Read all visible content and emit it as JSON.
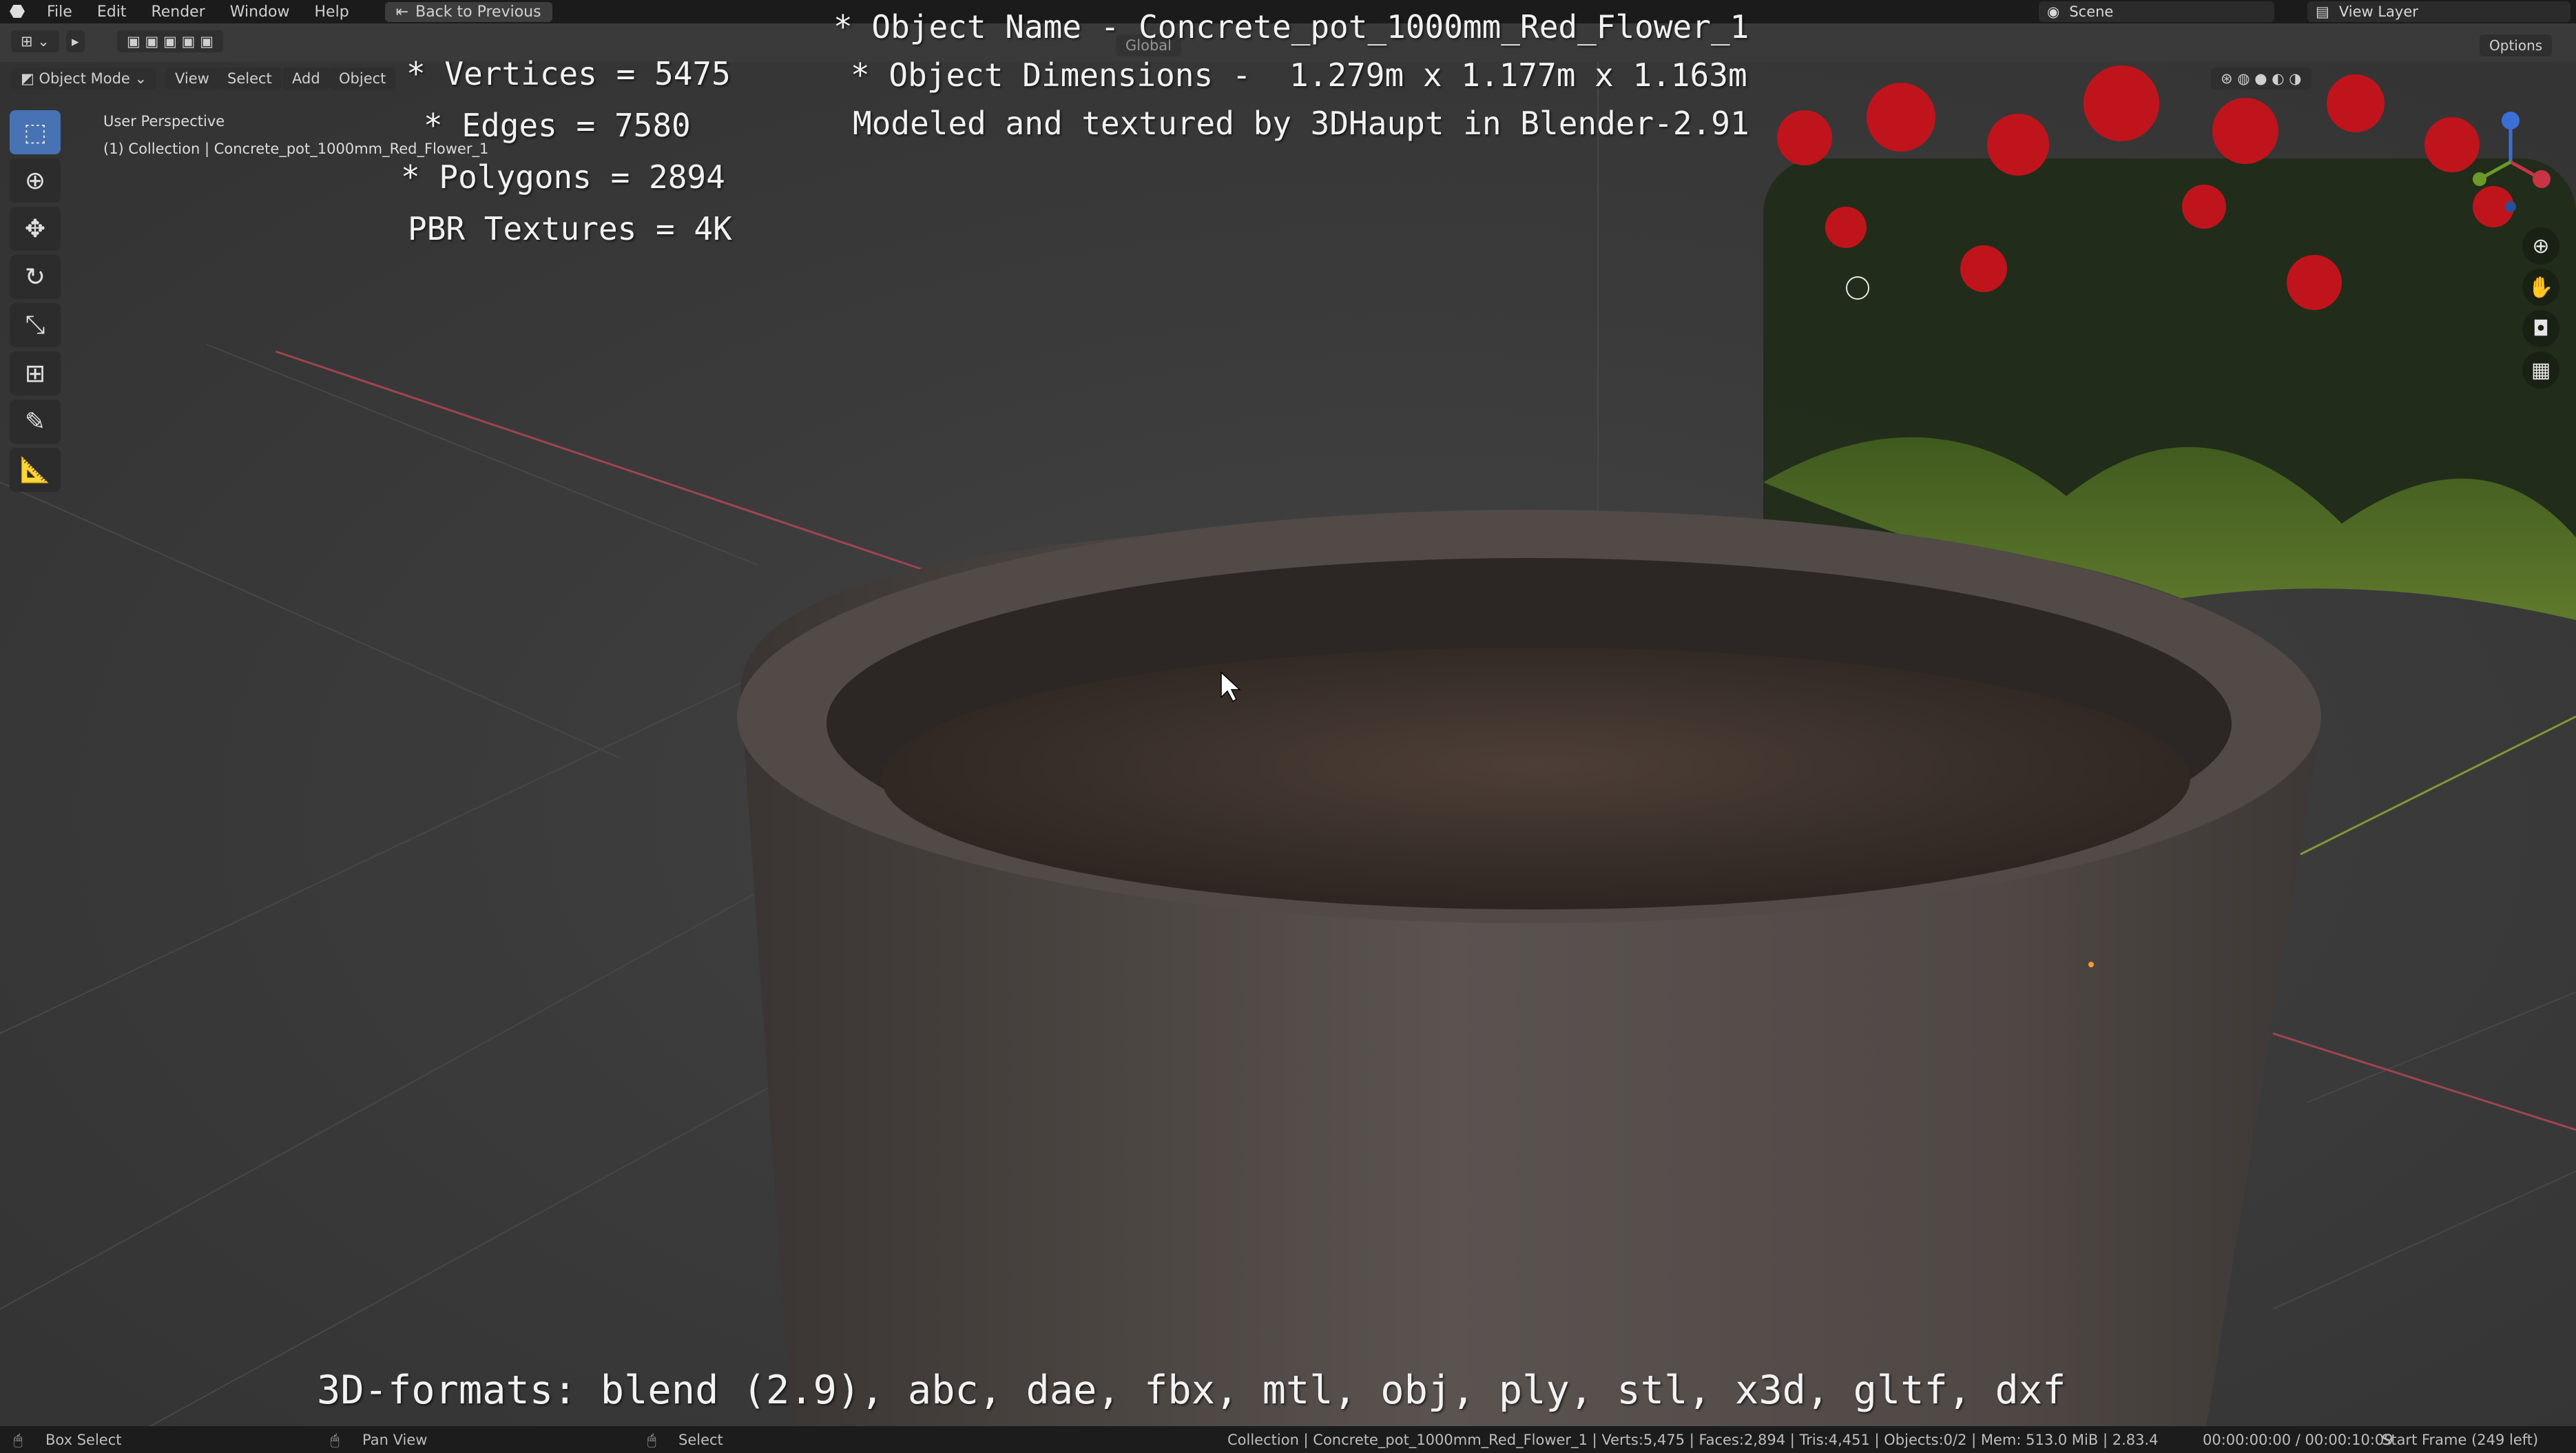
{
  "menu": {
    "items": [
      "File",
      "Edit",
      "Render",
      "Window",
      "Help"
    ],
    "back_button": "Back to Previous",
    "scene": "Scene",
    "view_layer": "View Layer"
  },
  "viewport_header": {
    "mode": "Object Mode",
    "menus": [
      "View",
      "Select",
      "Add",
      "Object"
    ],
    "transform": "Global",
    "options": "Options"
  },
  "viewport_info": {
    "perspective": "User Perspective",
    "collection": "(1) Collection | Concrete_pot_1000mm_Red_Flower_1"
  },
  "overlay": {
    "object_name": "* Object Name - Concrete_pot_1000mm_Red_Flower_1",
    "dimensions": "* Object Dimensions -  1.279m x 1.177m x 1.163m",
    "credit": "Modeled and textured by 3DHaupt in Blender-2.91",
    "vertices": "* Vertices = 5475",
    "edges": "* Edges = 7580",
    "polygons": "* Polygons = 2894",
    "textures": "PBR Textures = 4K",
    "formats": "3D-formats: blend (2.9), abc, dae, fbx, mtl, obj, ply, stl, x3d, gltf, dxf"
  },
  "statusbar": {
    "left": "Box Select",
    "middle": "Pan View",
    "right_action": "Select",
    "stats": "Collection | Concrete_pot_1000mm_Red_Flower_1 | Verts:5,475 | Faces:2,894 | Tris:4,451 | Objects:0/2 | Mem: 513.0 MiB | 2.83.4",
    "time": "00:00:00:00 / 00:00:10:09",
    "frame": "Start Frame (249 left)"
  },
  "colors": {
    "accent": "#4772b3",
    "menu_bg": "#1b1b1b",
    "x_axis": "#b04a55",
    "y_axis": "#8aa43a"
  },
  "icons": [
    "blender-logo-icon",
    "cursor-icon",
    "move-icon",
    "rotate-icon",
    "scale-icon",
    "transform-icon",
    "annotate-icon",
    "measure-icon",
    "zoom-icon",
    "hand-icon",
    "camera-icon",
    "grid-icon"
  ]
}
